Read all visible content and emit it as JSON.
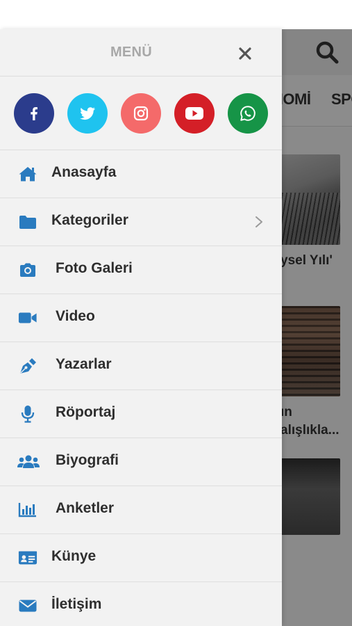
{
  "background": {
    "nav_items": [
      "NOMİ",
      "SPO"
    ],
    "captions": [
      "ysel Yılı'",
      "ın",
      "alışlıkla..."
    ]
  },
  "drawer": {
    "title": "MENÜ",
    "close_icon": "close-icon",
    "social": [
      {
        "name": "facebook",
        "icon": "facebook-icon",
        "color": "#2b3c8c"
      },
      {
        "name": "twitter",
        "icon": "twitter-icon",
        "color": "#1fc3ef"
      },
      {
        "name": "instagram",
        "icon": "instagram-icon",
        "color": "#f46a6a"
      },
      {
        "name": "youtube",
        "icon": "youtube-icon",
        "color": "#d41f27"
      },
      {
        "name": "whatsapp",
        "icon": "whatsapp-icon",
        "color": "#169447"
      }
    ],
    "items": [
      {
        "label": "Anasayfa",
        "icon": "home-icon"
      },
      {
        "label": "Kategoriler",
        "icon": "folder-icon",
        "has_submenu": true
      },
      {
        "label": "Foto Galeri",
        "icon": "camera-icon"
      },
      {
        "label": "Video",
        "icon": "video-camera-icon"
      },
      {
        "label": "Yazarlar",
        "icon": "pen-nib-icon"
      },
      {
        "label": "Röportaj",
        "icon": "microphone-icon"
      },
      {
        "label": "Biyografi",
        "icon": "users-icon"
      },
      {
        "label": "Anketler",
        "icon": "poll-chart-icon"
      },
      {
        "label": "Künye",
        "icon": "id-card-icon"
      },
      {
        "label": "İletişim",
        "icon": "envelope-icon"
      }
    ]
  },
  "colors": {
    "icon_blue": "#2a7bbf",
    "drawer_bg": "#f2f2f2",
    "menu_title": "#a8a8a8"
  }
}
